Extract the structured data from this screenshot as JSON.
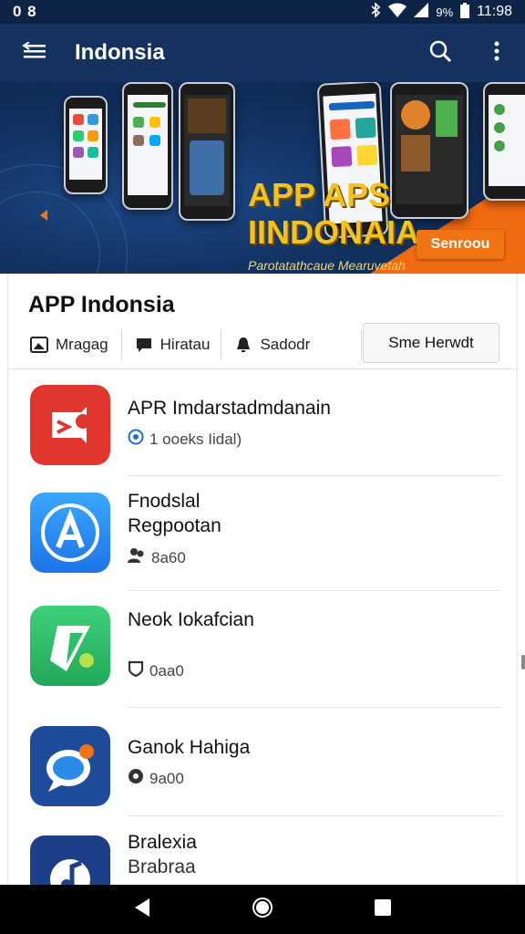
{
  "status_bar": {
    "left_text": "0 8",
    "battery": "9%",
    "time": "11:98",
    "icons": [
      "bluetooth-icon",
      "wifi-icon",
      "signal-icon",
      "battery-icon"
    ]
  },
  "app_bar": {
    "title": "Indonsia",
    "icons": [
      "menu-icon",
      "search-icon",
      "more-vert-icon"
    ]
  },
  "banner": {
    "headline_1": "APP APS",
    "headline_2": "IINDONAIA",
    "subtitle": "Parotatathcaue Mearuvetah",
    "cta_label": "Senroou",
    "slides": 4,
    "active_slide": 1
  },
  "section": {
    "title": "APP Indonsia",
    "filters": [
      {
        "label": "Mragag",
        "icon": "image-icon"
      },
      {
        "label": "Hiratau",
        "icon": "chat-icon"
      },
      {
        "label": "Sadodr",
        "icon": "bell-icon"
      }
    ],
    "sort_label": "Sme Herwdt"
  },
  "apps": [
    {
      "name": "APR Imdarstadmdanain",
      "name2": "",
      "meta": "1 ooeks Iidal)",
      "meta_icon": "globe-icon",
      "icon_name": "app-icon-red-video",
      "color": "#e0362f"
    },
    {
      "name": "Fnodslal",
      "name2": "Regpootan",
      "meta": "8a60",
      "meta_icon": "users-icon",
      "icon_name": "app-icon-blue-a",
      "color": "#2c8df0"
    },
    {
      "name": "Neok Iokafcian",
      "name2": "",
      "meta": "0aa0",
      "meta_icon": "shield-icon",
      "icon_name": "app-icon-green-arrow",
      "color": "#2fbf6a"
    },
    {
      "name": "Ganok Hahiga",
      "name2": "",
      "meta": "9a00",
      "meta_icon": "location-icon",
      "icon_name": "app-icon-blue-chat",
      "color": "#1e4c9a"
    },
    {
      "name": "Bralexia",
      "name2": "Brabraa",
      "meta": "",
      "meta_icon": "",
      "icon_name": "app-icon-navy-music",
      "color": "#1d3f8a"
    }
  ],
  "nav_bar": {
    "icons": [
      "back-icon",
      "home-icon",
      "recents-icon"
    ]
  },
  "colors": {
    "app_bar": "#14315f",
    "status_bar": "#0e2447",
    "accent_orange": "#f07314",
    "banner_yellow": "#f5c21b"
  }
}
